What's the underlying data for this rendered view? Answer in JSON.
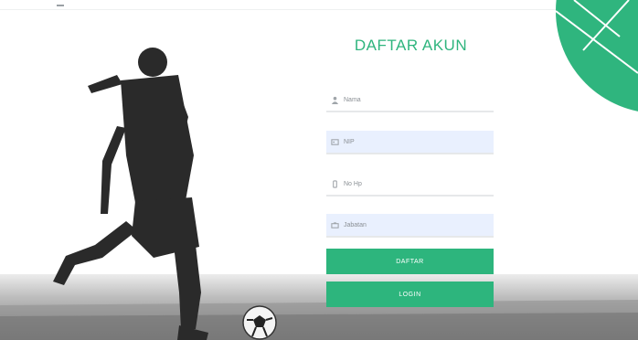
{
  "form": {
    "title": "DAFTAR AKUN",
    "fields": [
      {
        "placeholder": "Nama",
        "icon": "user-icon"
      },
      {
        "placeholder": "NIP",
        "icon": "id-card-icon"
      },
      {
        "placeholder": "No Hp",
        "icon": "phone-icon"
      },
      {
        "placeholder": "Jabatan",
        "icon": "briefcase-icon"
      }
    ],
    "register_label": "DAFTAR",
    "login_label": "LOGIN"
  },
  "colors": {
    "accent": "#2db57d",
    "title": "#2fb57e",
    "filled_field": "#e9f0fe"
  }
}
